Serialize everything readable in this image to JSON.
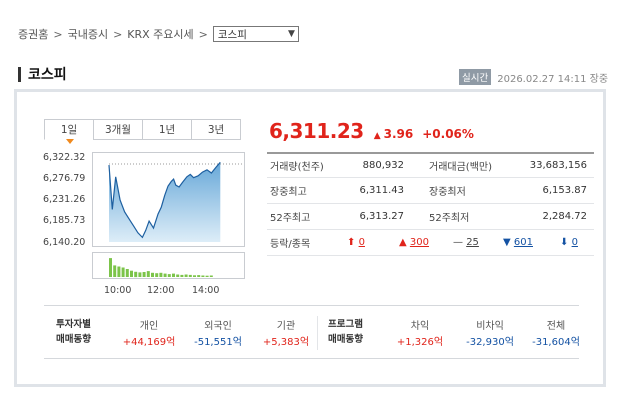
{
  "breadcrumb": {
    "items": [
      "증권홈",
      "국내증시",
      "KRX 주요시세"
    ],
    "selected": "코스피"
  },
  "header": {
    "title": "코스피",
    "realtime_label": "실시간",
    "datetime": "2026.02.27 14:11 장중"
  },
  "tabs": [
    "1일",
    "3개월",
    "1년",
    "3년"
  ],
  "quote": {
    "price": "6,311.23",
    "change": "3.96",
    "change_pct": "+0.06%"
  },
  "stats": {
    "volume_label": "거래량(천주)",
    "volume": "880,932",
    "amount_label": "거래대금(백만)",
    "amount": "33,683,156",
    "day_high_label": "장중최고",
    "day_high": "6,311.43",
    "day_low_label": "장중최저",
    "day_low": "6,153.87",
    "w52_high_label": "52주최고",
    "w52_high": "6,313.27",
    "w52_low_label": "52주최저",
    "w52_low": "2,284.72",
    "adv_label": "등락/종목",
    "upper_limit": "0",
    "rise": "300",
    "unchanged": "25",
    "fall": "601",
    "lower_limit": "0"
  },
  "investors": {
    "group_label_1": "투자자별",
    "group_label_2": "매매동향",
    "cols": [
      {
        "name": "개인",
        "value": "+44,169억"
      },
      {
        "name": "외국인",
        "value": "-51,551억"
      },
      {
        "name": "기관",
        "value": "+5,383억"
      }
    ]
  },
  "program": {
    "group_label_1": "프로그램",
    "group_label_2": "매매동향",
    "cols": [
      {
        "name": "차익",
        "value": "+1,326억"
      },
      {
        "name": "비차익",
        "value": "-32,930억"
      },
      {
        "name": "전체",
        "value": "-31,604억"
      }
    ]
  },
  "chart_data": {
    "type": "area",
    "y_ticks": [
      "6,322.32",
      "6,276.79",
      "6,231.26",
      "6,185.73",
      "6,140.20"
    ],
    "x_ticks": [
      "10:00",
      "12:00",
      "14:00"
    ],
    "ylim": [
      6140.2,
      6322.32
    ],
    "prev_close": 6307.27,
    "x": [
      0,
      0.03,
      0.06,
      0.1,
      0.14,
      0.18,
      0.22,
      0.26,
      0.3,
      0.33,
      0.36,
      0.4,
      0.44,
      0.47,
      0.5,
      0.53,
      0.56,
      0.58,
      0.6,
      0.63,
      0.66,
      0.7,
      0.73,
      0.76,
      0.8,
      0.84,
      0.88,
      0.92,
      0.96,
      1.0
    ],
    "values": [
      6305,
      6210,
      6280,
      6230,
      6205,
      6190,
      6175,
      6160,
      6150,
      6165,
      6185,
      6170,
      6200,
      6215,
      6240,
      6260,
      6270,
      6275,
      6262,
      6258,
      6268,
      6280,
      6285,
      6278,
      6282,
      6290,
      6295,
      6288,
      6300,
      6311
    ],
    "volume": [
      0.9,
      0.55,
      0.5,
      0.45,
      0.38,
      0.3,
      0.25,
      0.22,
      0.24,
      0.28,
      0.2,
      0.18,
      0.2,
      0.16,
      0.14,
      0.16,
      0.12,
      0.1,
      0.12,
      0.1,
      0.08,
      0.09,
      0.07,
      0.06,
      0.07
    ]
  }
}
